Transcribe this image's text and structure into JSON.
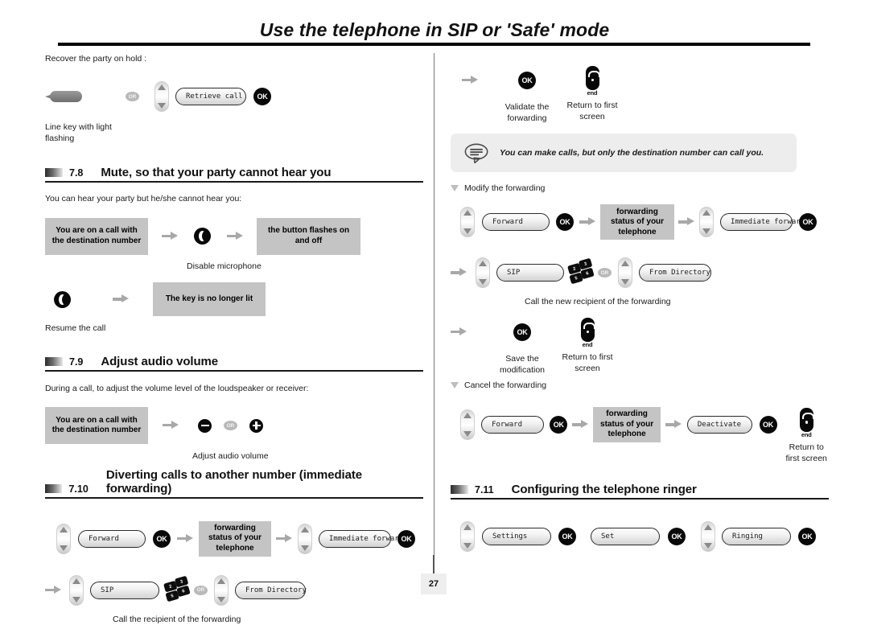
{
  "document": {
    "title": "Use the telephone in SIP or 'Safe' mode",
    "page_number": "27"
  },
  "icons": {
    "ok": "OK",
    "or": "OR",
    "end": "end",
    "keypad_digits": [
      "2",
      "3",
      "5",
      "6"
    ]
  },
  "left_column": {
    "intro": "Recover the party on hold :",
    "retrieve_flow": {
      "softkey": "Retrieve call",
      "line_key_caption": "Line key with light\nflashing",
      "line_key_caption_line1": "Line key with light",
      "line_key_caption_line2": "flashing"
    },
    "section_7_8": {
      "number": "7.8",
      "title": "Mute, so that your party cannot hear you",
      "intro": "You can hear your party but he/she cannot hear you:",
      "box_start": "You are on a call with the destination number",
      "mute_caption": "Disable microphone",
      "box_result": "the button flashes on and off",
      "resume_caption": "Resume the call",
      "box_resume_result": "The key is no longer lit"
    },
    "section_7_9": {
      "number": "7.9",
      "title": "Adjust audio volume",
      "intro": "During a call, to adjust the volume level of the loudspeaker or receiver:",
      "box_start": "You are on a call with the destination number",
      "caption": "Adjust audio volume"
    },
    "section_7_10": {
      "number": "7.10",
      "title": "Diverting calls to another number (immediate forwarding)",
      "step_forward": "Forward",
      "status_box": "forwarding status of your telephone",
      "step_immediate": "Immediate forward",
      "step_sip": "SIP",
      "step_directory": "From Directory",
      "caption": "Call the recipient of the forwarding"
    }
  },
  "right_column": {
    "validate_caption_line1": "Validate the",
    "validate_caption_line2": "forwarding",
    "return_caption_line1": "Return to first",
    "return_caption_line2": "screen",
    "note": "You can make calls, but only the destination number can call you.",
    "modify": {
      "heading": "Modify the forwarding",
      "step_forward": "Forward",
      "status_box": "forwarding status of your telephone",
      "step_immediate": "Immediate forward",
      "step_sip": "SIP",
      "step_directory": "From Directory",
      "caption": "Call the new recipient of the forwarding",
      "save_caption_line1": "Save the",
      "save_caption_line2": "modification",
      "return_caption_line1": "Return to first",
      "return_caption_line2": "screen"
    },
    "cancel": {
      "heading": "Cancel the forwarding",
      "step_forward": "Forward",
      "status_box": "forwarding status of your telephone",
      "step_deactivate": "Deactivate",
      "return_caption_line1": "Return to",
      "return_caption_line2": "first screen"
    },
    "section_7_11": {
      "number": "7.11",
      "title": "Configuring the telephone ringer",
      "step_settings": "Settings",
      "step_set": "Set",
      "step_ringing": "Ringing"
    }
  }
}
